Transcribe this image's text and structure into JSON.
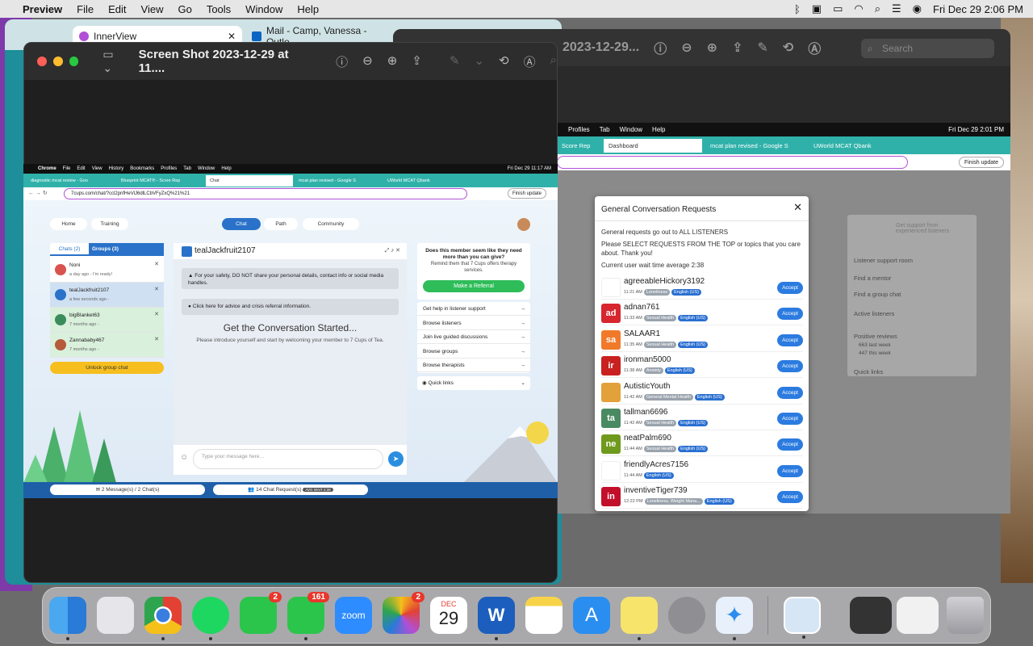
{
  "menubar": {
    "app": "Preview",
    "items": [
      "File",
      "Edit",
      "View",
      "Go",
      "Tools",
      "Window",
      "Help"
    ],
    "clock": "Fri Dec 29  2:06 PM"
  },
  "bg_browser": {
    "tab1": "InnerView",
    "tab2": "Mail - Camp, Vanessa - Outlo"
  },
  "preview_left": {
    "title": "Screen Shot 2023-12-29 at 11...."
  },
  "preview_right": {
    "title": "2023-12-29...",
    "search_placeholder": "Search"
  },
  "shot_left": {
    "menubar": {
      "app": "Chrome",
      "items": [
        "File",
        "Edit",
        "View",
        "History",
        "Bookmarks",
        "Profiles",
        "Tab",
        "Window",
        "Help"
      ],
      "clock": "Fri Dec 29  11:17 AM"
    },
    "tabs": [
      "diagnostic mcat review - Goo",
      "Blueprint MCAT® - Score Rep",
      "Chat",
      "mcat plan revised - Google S",
      "UWorld MCAT Qbank"
    ],
    "url": "7cups.com/chat/?ccl2pnfHeVlJ6dlLCbVFyZxQ%21%21",
    "finish_update": "Finish update",
    "nav": {
      "home": "Home",
      "training": "Training",
      "chat": "Chat",
      "path": "Path",
      "community": "Community"
    },
    "chats_tab": "Chats (2)",
    "groups_tab": "Groups (3)",
    "chats": [
      {
        "name": "Noni",
        "time": "a day ago - I'm ready!",
        "color": "#d9534f"
      },
      {
        "name": "tealJackfruit2107",
        "time": "a few seconds ago -",
        "color": "#2a72c9"
      },
      {
        "name": "bigBlanket63",
        "time": "7 months ago -",
        "color": "#3a8d5a"
      },
      {
        "name": "Zannababy467",
        "time": "7 months ago -",
        "color": "#b55a3a"
      }
    ],
    "unlock": "Unlock group chat",
    "chat_title": "tealJackfruit2107",
    "safety": "For your safety, DO NOT share your personal details, contact info or social media handles.",
    "advice": "Click here for advice and crisis referral information.",
    "started_title": "Get the Conversation Started...",
    "started_sub": "Please introduce yourself and start by welcoming your member to 7 Cups of Tea.",
    "input_placeholder": "Type your message here...",
    "referral_q": "Does this member seem like they need more than you can give?",
    "referral_sub": "Remind them that 7 Cups offers therapy services.",
    "referral_btn": "Make a Referral",
    "links": [
      "Get help in listener support",
      "Browse listeners",
      "Join live guided discussions",
      "Browse groups",
      "Browse therapists"
    ],
    "quick_links": "Quick links",
    "footer_messages": "2 Message(s) / 2 Chat(s)",
    "footer_requests": "14 Chat Request(s)",
    "footer_badge": "AVG WAIT 2:38"
  },
  "shot_right": {
    "menubar": {
      "items": [
        "Profiles",
        "Tab",
        "Window",
        "Help"
      ],
      "clock": "Fri Dec 29  2:01 PM"
    },
    "tabs": [
      "Score Rep",
      "Dashboard",
      "mcat plan revised - Google S",
      "UWorld MCAT Qbank"
    ],
    "finish_update": "Finish update",
    "side": {
      "support": "Get support from experienced listeners",
      "links": [
        "Listener support room",
        "Find a mentor",
        "Find a group chat"
      ],
      "active": "Active listeners",
      "positive": "Positive reviews",
      "last_week": "663 last week",
      "this_week": "447 this week",
      "quick": "Quick links"
    }
  },
  "modal": {
    "title": "General Conversation Requests",
    "line1": "General requests go out to ALL LISTENERS",
    "line2": "Please SELECT REQUESTS FROM THE TOP or topics that you care about. Thank you!",
    "line3": "Current user wait time average 2:38",
    "accept": "Accept",
    "requests": [
      {
        "name": "agreeableHickory3192",
        "initials": "",
        "color": "#ffffff",
        "time": "11:21 AM",
        "tags": [
          "Loneliness"
        ],
        "lang": "English (US)"
      },
      {
        "name": "adnan761",
        "initials": "ad",
        "color": "#d7262e",
        "time": "11:33 AM",
        "tags": [
          "Sexual Health"
        ],
        "lang": "English (US)"
      },
      {
        "name": "SALAAR1",
        "initials": "sa",
        "color": "#f07a2a",
        "time": "11:35 AM",
        "tags": [
          "Sexual Health"
        ],
        "lang": "English (US)"
      },
      {
        "name": "ironman5000",
        "initials": "ir",
        "color": "#c8211f",
        "time": "11:38 AM",
        "tags": [
          "Anxiety"
        ],
        "lang": "English (US)"
      },
      {
        "name": "AutisticYouth",
        "initials": "",
        "color": "#e2a13a",
        "time": "11:42 AM",
        "tags": [
          "General Mental Health"
        ],
        "lang": "English (US)"
      },
      {
        "name": "tallman6696",
        "initials": "ta",
        "color": "#4a8a62",
        "time": "11:42 AM",
        "tags": [
          "Sexual Health"
        ],
        "lang": "English (US)"
      },
      {
        "name": "neatPalm690",
        "initials": "ne",
        "color": "#6f9a1e",
        "time": "11:44 AM",
        "tags": [
          "Sexual Health"
        ],
        "lang": "English (US)"
      },
      {
        "name": "friendlyAcres7156",
        "initials": "",
        "color": "#ffffff",
        "time": "11:44 AM",
        "tags": [],
        "lang": "English (US)"
      },
      {
        "name": "inventiveTiger739",
        "initials": "in",
        "color": "#c2102a",
        "time": "12:22 PM",
        "tags": [
          "Loneliness, Weight Mana..."
        ],
        "lang": "English (US)"
      }
    ]
  },
  "dock": {
    "facetime_badge": "2",
    "messages_badge": "161",
    "photos_badge": "2",
    "calendar_month": "DEC",
    "calendar_day": "29",
    "zoom_label": "zoom"
  }
}
